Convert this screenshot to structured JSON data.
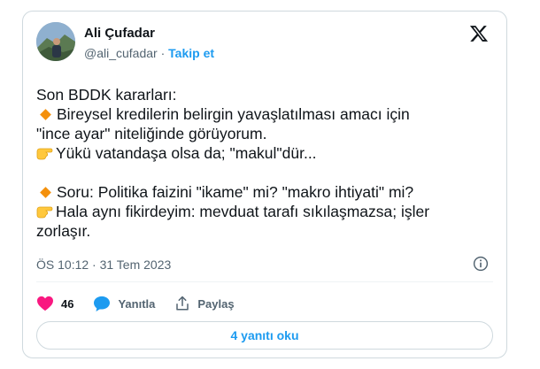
{
  "author": {
    "name": "Ali Çufadar",
    "handle": "@ali_cufadar",
    "separator": "·",
    "follow_label": "Takip et"
  },
  "platform_icon": "x-logo-icon",
  "tweet": {
    "lines": [
      {
        "prefix": "",
        "text": "Son BDDK kararları:"
      },
      {
        "prefix": "diamond",
        "text": "Bireysel kredilerin belirgin yavaşlatılması amacı için"
      },
      {
        "prefix": "",
        "text": "\"ince ayar\" niteliğinde görüyorum."
      },
      {
        "prefix": "pointing",
        "text": "Yükü vatandaşa olsa da; \"makul\"dür..."
      },
      {
        "prefix": "",
        "text": ""
      },
      {
        "prefix": "diamond",
        "text": "Soru: Politika faizini \"ikame\" mi? \"makro ihtiyati\" mi?"
      },
      {
        "prefix": "pointing",
        "text": "Hala aynı fikirdeyim: mevduat tarafı sıkılaşmazsa; işler"
      },
      {
        "prefix": "",
        "text": "zorlaşır."
      }
    ]
  },
  "timestamp": "ÖS 10:12 · 31 Tem 2023",
  "actions": {
    "likes_count": "46",
    "reply_label": "Yanıtla",
    "share_label": "Paylaş"
  },
  "read_replies_label": "4 yanıtı oku",
  "colors": {
    "accent": "#1d9bf0",
    "like": "#f91880",
    "diamond": "#f4900c",
    "muted": "#536471"
  }
}
